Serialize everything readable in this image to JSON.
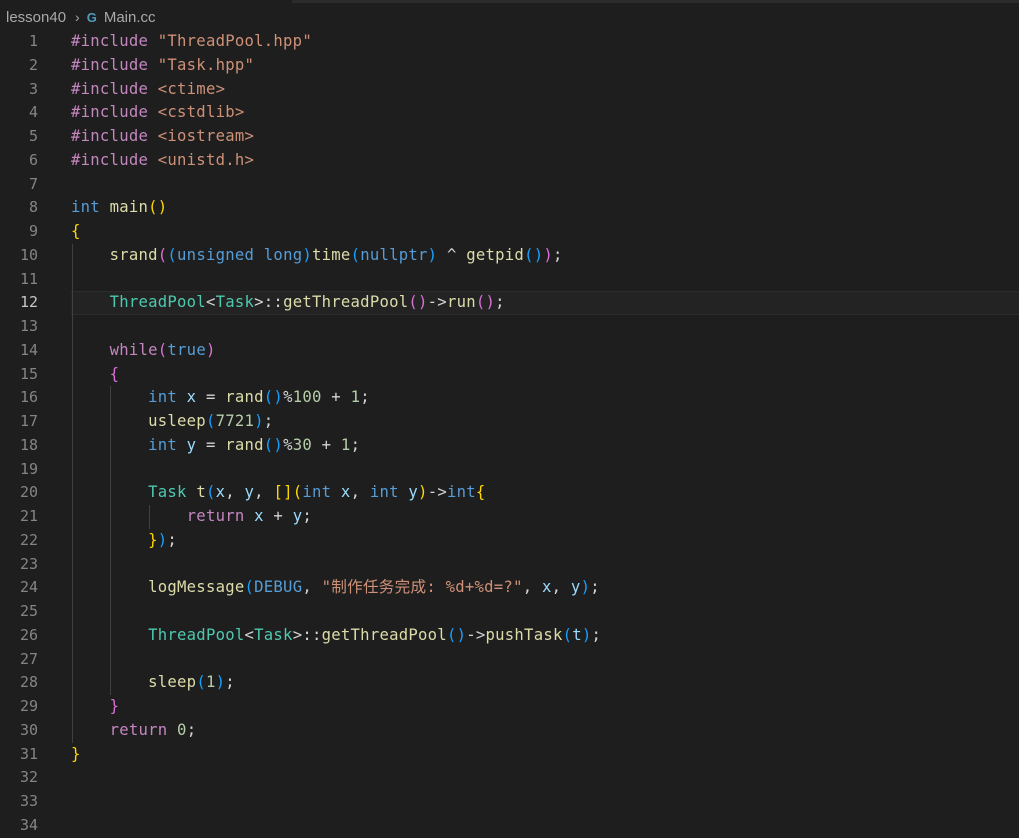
{
  "breadcrumb": {
    "folder": "lesson40",
    "file_icon": "cpp-file-icon",
    "file_icon_glyph": "G",
    "file": "Main.cc",
    "separator": "›"
  },
  "editor": {
    "current_line": 12,
    "lines": [
      {
        "n": "1",
        "tokens": [
          [
            "pp",
            "#include "
          ],
          [
            "str",
            "\"ThreadPool.hpp\""
          ]
        ]
      },
      {
        "n": "2",
        "tokens": [
          [
            "pp",
            "#include "
          ],
          [
            "str",
            "\"Task.hpp\""
          ]
        ]
      },
      {
        "n": "3",
        "tokens": [
          [
            "pp",
            "#include "
          ],
          [
            "str",
            "<ctime>"
          ]
        ]
      },
      {
        "n": "4",
        "tokens": [
          [
            "pp",
            "#include "
          ],
          [
            "str",
            "<cstdlib>"
          ]
        ]
      },
      {
        "n": "5",
        "tokens": [
          [
            "pp",
            "#include "
          ],
          [
            "str",
            "<iostream>"
          ]
        ]
      },
      {
        "n": "6",
        "tokens": [
          [
            "pp",
            "#include "
          ],
          [
            "str",
            "<unistd.h>"
          ]
        ]
      },
      {
        "n": "7",
        "tokens": []
      },
      {
        "n": "8",
        "tokens": [
          [
            "kw",
            "int"
          ],
          [
            "plain",
            " "
          ],
          [
            "fn",
            "main"
          ],
          [
            "br1",
            "()"
          ]
        ]
      },
      {
        "n": "9",
        "tokens": [
          [
            "br1",
            "{"
          ]
        ]
      },
      {
        "n": "10",
        "tokens": [
          [
            "plain",
            "    "
          ],
          [
            "fn",
            "srand"
          ],
          [
            "br2",
            "("
          ],
          [
            "br3",
            "("
          ],
          [
            "kw",
            "unsigned long"
          ],
          [
            "br3",
            ")"
          ],
          [
            "fn",
            "time"
          ],
          [
            "br3",
            "("
          ],
          [
            "kw",
            "nullptr"
          ],
          [
            "br3",
            ")"
          ],
          [
            "plain",
            " ^ "
          ],
          [
            "fn",
            "getpid"
          ],
          [
            "br3",
            "()"
          ],
          [
            "br2",
            ")"
          ],
          [
            "plain",
            ";"
          ]
        ]
      },
      {
        "n": "11",
        "tokens": []
      },
      {
        "n": "12",
        "tokens": [
          [
            "plain",
            "    "
          ],
          [
            "type",
            "ThreadPool"
          ],
          [
            "plain",
            "<"
          ],
          [
            "type",
            "Task"
          ],
          [
            "plain",
            ">::"
          ],
          [
            "fn",
            "getThreadPool"
          ],
          [
            "br2",
            "()"
          ],
          [
            "plain",
            "->"
          ],
          [
            "fn",
            "run"
          ],
          [
            "br2",
            "()"
          ],
          [
            "plain",
            ";"
          ]
        ]
      },
      {
        "n": "13",
        "tokens": []
      },
      {
        "n": "14",
        "tokens": [
          [
            "plain",
            "    "
          ],
          [
            "ctl",
            "while"
          ],
          [
            "br2",
            "("
          ],
          [
            "kw",
            "true"
          ],
          [
            "br2",
            ")"
          ]
        ]
      },
      {
        "n": "15",
        "tokens": [
          [
            "plain",
            "    "
          ],
          [
            "br2",
            "{"
          ]
        ]
      },
      {
        "n": "16",
        "tokens": [
          [
            "plain",
            "        "
          ],
          [
            "kw",
            "int"
          ],
          [
            "plain",
            " "
          ],
          [
            "var",
            "x"
          ],
          [
            "plain",
            " = "
          ],
          [
            "fn",
            "rand"
          ],
          [
            "br3",
            "()"
          ],
          [
            "plain",
            "%"
          ],
          [
            "num",
            "100"
          ],
          [
            "plain",
            " + "
          ],
          [
            "num",
            "1"
          ],
          [
            "plain",
            ";"
          ]
        ]
      },
      {
        "n": "17",
        "tokens": [
          [
            "plain",
            "        "
          ],
          [
            "fn",
            "usleep"
          ],
          [
            "br3",
            "("
          ],
          [
            "num",
            "7721"
          ],
          [
            "br3",
            ")"
          ],
          [
            "plain",
            ";"
          ]
        ]
      },
      {
        "n": "18",
        "tokens": [
          [
            "plain",
            "        "
          ],
          [
            "kw",
            "int"
          ],
          [
            "plain",
            " "
          ],
          [
            "var",
            "y"
          ],
          [
            "plain",
            " = "
          ],
          [
            "fn",
            "rand"
          ],
          [
            "br3",
            "()"
          ],
          [
            "plain",
            "%"
          ],
          [
            "num",
            "30"
          ],
          [
            "plain",
            " + "
          ],
          [
            "num",
            "1"
          ],
          [
            "plain",
            ";"
          ]
        ]
      },
      {
        "n": "19",
        "tokens": []
      },
      {
        "n": "20",
        "tokens": [
          [
            "plain",
            "        "
          ],
          [
            "type",
            "Task"
          ],
          [
            "plain",
            " "
          ],
          [
            "fn",
            "t"
          ],
          [
            "br3",
            "("
          ],
          [
            "var",
            "x"
          ],
          [
            "plain",
            ", "
          ],
          [
            "var",
            "y"
          ],
          [
            "plain",
            ", "
          ],
          [
            "br1",
            "[]"
          ],
          [
            "br1",
            "("
          ],
          [
            "kw",
            "int"
          ],
          [
            "plain",
            " "
          ],
          [
            "var",
            "x"
          ],
          [
            "plain",
            ", "
          ],
          [
            "kw",
            "int"
          ],
          [
            "plain",
            " "
          ],
          [
            "var",
            "y"
          ],
          [
            "br1",
            ")"
          ],
          [
            "plain",
            "->"
          ],
          [
            "kw",
            "int"
          ],
          [
            "br1",
            "{"
          ]
        ]
      },
      {
        "n": "21",
        "tokens": [
          [
            "plain",
            "            "
          ],
          [
            "ctl",
            "return"
          ],
          [
            "plain",
            " "
          ],
          [
            "var",
            "x"
          ],
          [
            "plain",
            " + "
          ],
          [
            "var",
            "y"
          ],
          [
            "plain",
            ";"
          ]
        ]
      },
      {
        "n": "22",
        "tokens": [
          [
            "plain",
            "        "
          ],
          [
            "br1",
            "}"
          ],
          [
            "br3",
            ")"
          ],
          [
            "plain",
            ";"
          ]
        ]
      },
      {
        "n": "23",
        "tokens": []
      },
      {
        "n": "24",
        "tokens": [
          [
            "plain",
            "        "
          ],
          [
            "fn",
            "logMessage"
          ],
          [
            "br3",
            "("
          ],
          [
            "kw",
            "DEBUG"
          ],
          [
            "plain",
            ", "
          ],
          [
            "str",
            "\"制作任务完成: %d+%d=?\""
          ],
          [
            "plain",
            ", "
          ],
          [
            "var",
            "x"
          ],
          [
            "plain",
            ", "
          ],
          [
            "var",
            "y"
          ],
          [
            "br3",
            ")"
          ],
          [
            "plain",
            ";"
          ]
        ]
      },
      {
        "n": "25",
        "tokens": []
      },
      {
        "n": "26",
        "tokens": [
          [
            "plain",
            "        "
          ],
          [
            "type",
            "ThreadPool"
          ],
          [
            "plain",
            "<"
          ],
          [
            "type",
            "Task"
          ],
          [
            "plain",
            ">::"
          ],
          [
            "fn",
            "getThreadPool"
          ],
          [
            "br3",
            "()"
          ],
          [
            "plain",
            "->"
          ],
          [
            "fn",
            "pushTask"
          ],
          [
            "br3",
            "("
          ],
          [
            "var",
            "t"
          ],
          [
            "br3",
            ")"
          ],
          [
            "plain",
            ";"
          ]
        ]
      },
      {
        "n": "27",
        "tokens": []
      },
      {
        "n": "28",
        "tokens": [
          [
            "plain",
            "        "
          ],
          [
            "fn",
            "sleep"
          ],
          [
            "br3",
            "("
          ],
          [
            "num",
            "1"
          ],
          [
            "br3",
            ")"
          ],
          [
            "plain",
            ";"
          ]
        ]
      },
      {
        "n": "29",
        "tokens": [
          [
            "plain",
            "    "
          ],
          [
            "br2",
            "}"
          ]
        ]
      },
      {
        "n": "30",
        "tokens": [
          [
            "plain",
            "    "
          ],
          [
            "ctl",
            "return"
          ],
          [
            "plain",
            " "
          ],
          [
            "num",
            "0"
          ],
          [
            "plain",
            ";"
          ]
        ]
      },
      {
        "n": "31",
        "tokens": [
          [
            "br1",
            "}"
          ]
        ]
      },
      {
        "n": "32",
        "tokens": []
      },
      {
        "n": "33",
        "tokens": []
      },
      {
        "n": "34",
        "tokens": []
      }
    ]
  },
  "colors": {
    "background": "#1e1e1e",
    "preprocessor": "#c586c0",
    "string": "#ce9178",
    "keyword": "#569cd6",
    "function": "#dcdcaa",
    "type": "#4ec9b0",
    "number": "#b5cea8",
    "variable": "#9cdcfe"
  }
}
